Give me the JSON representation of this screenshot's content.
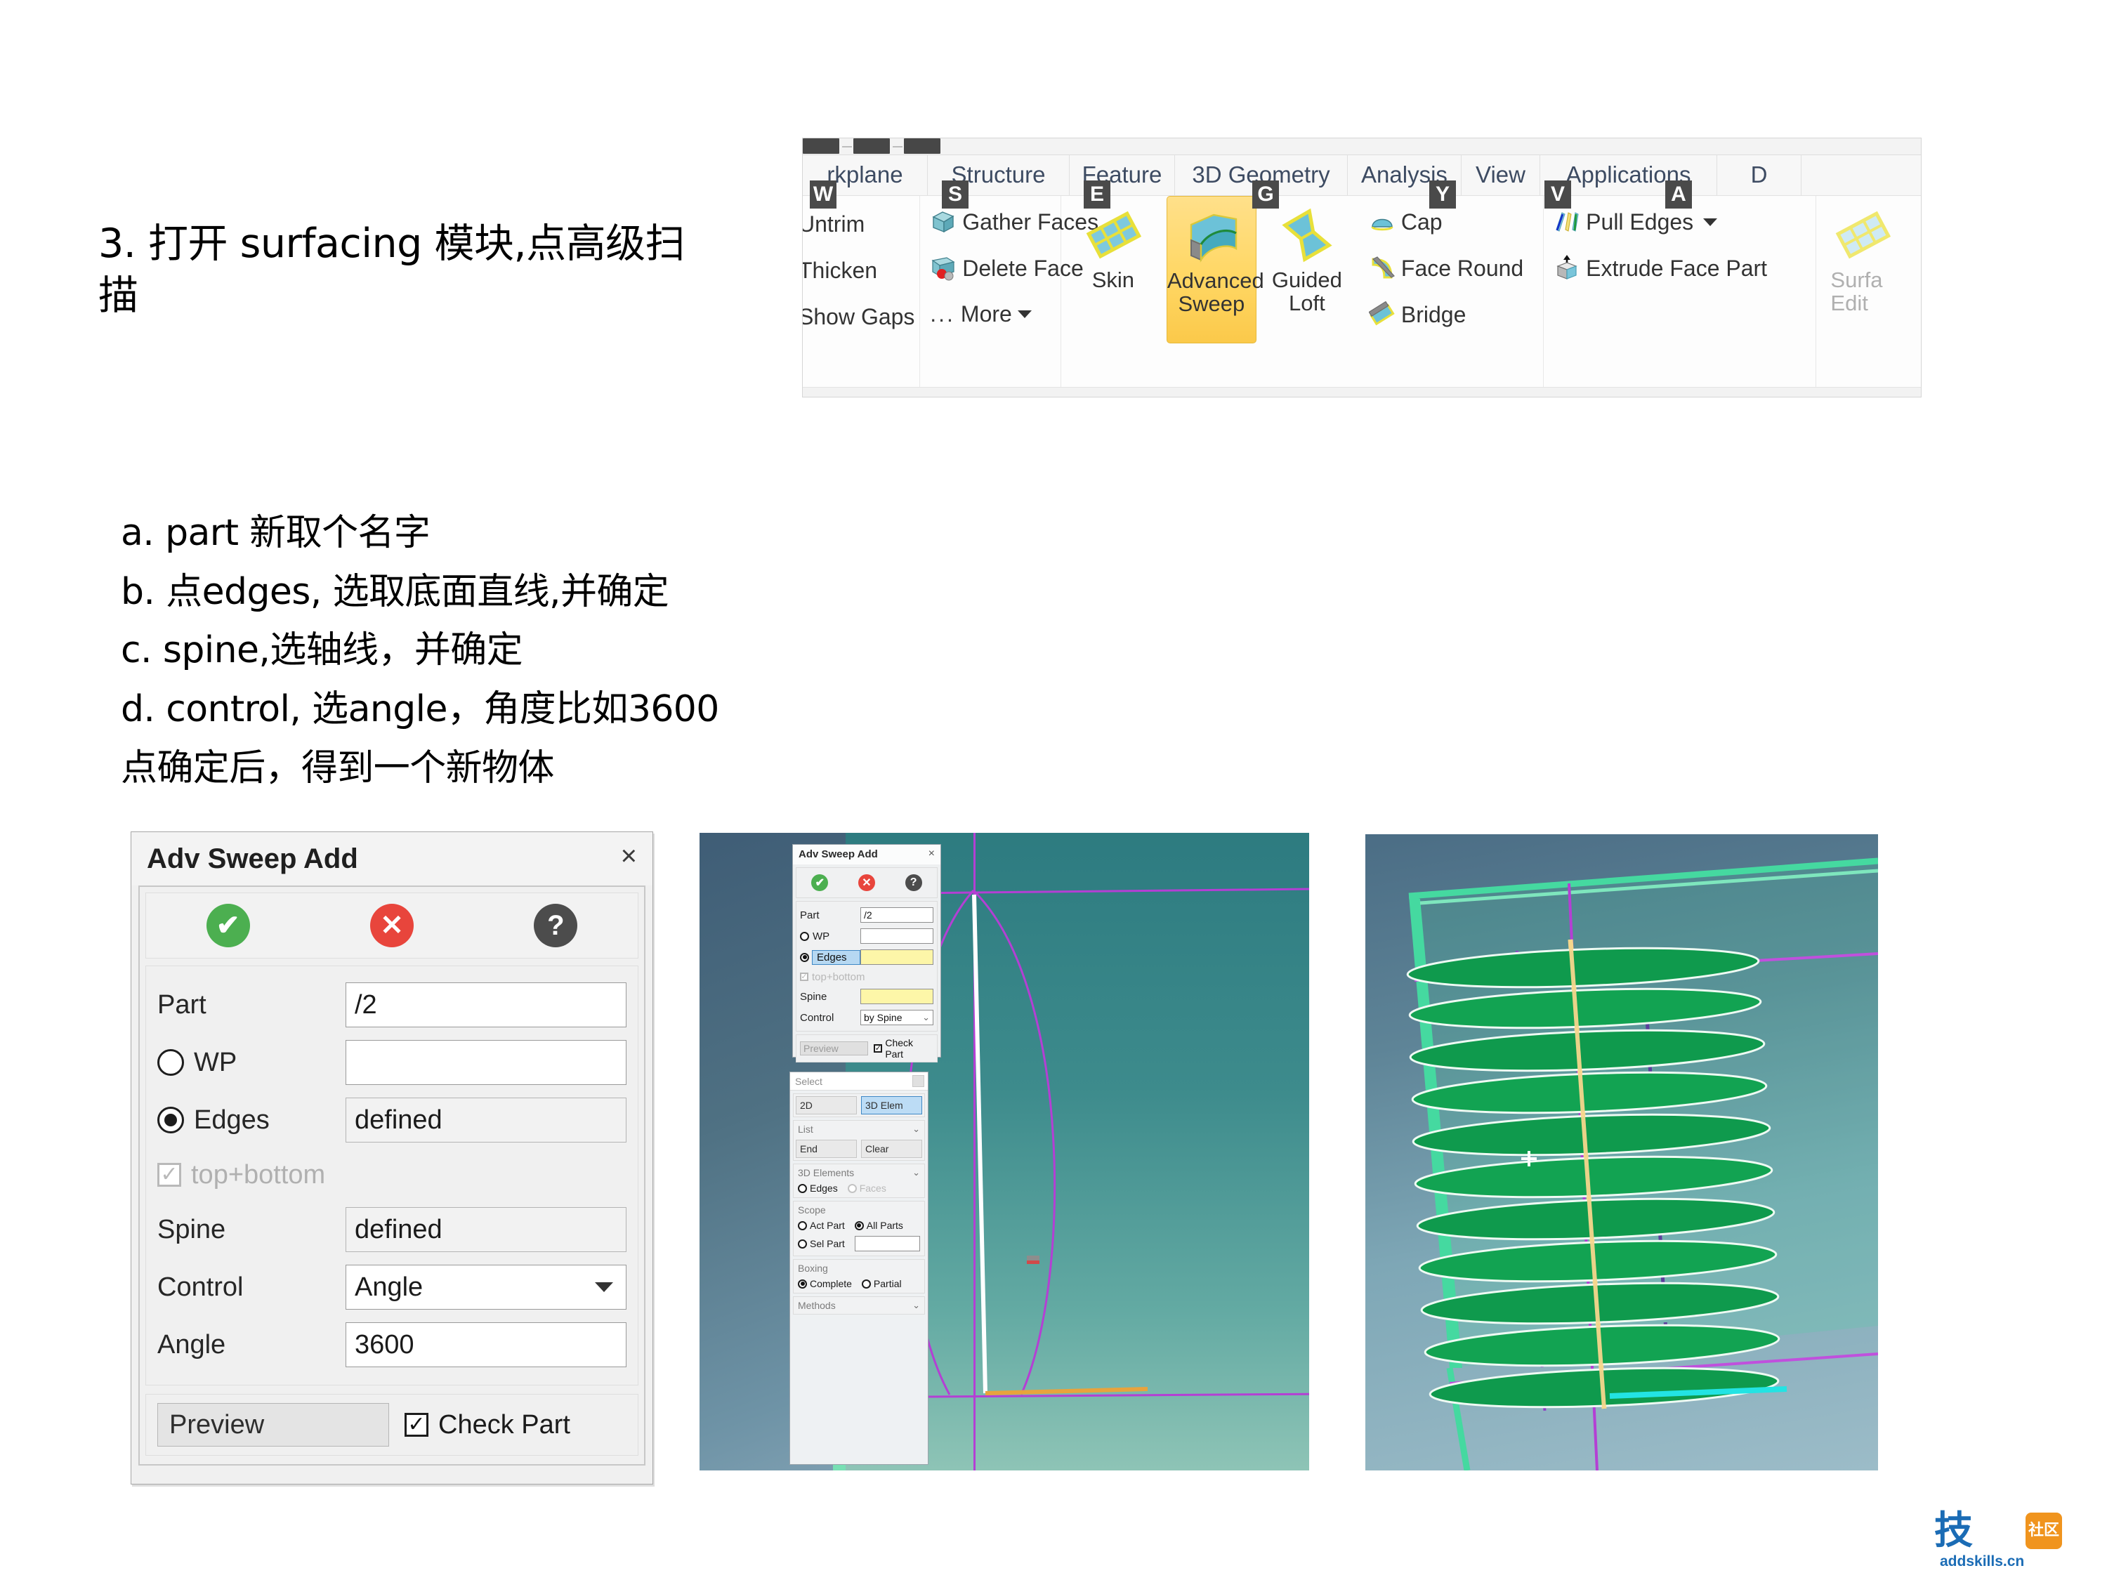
{
  "slide": {
    "heading_line1": "3. 打开 surfacing 模块,点高级扫",
    "heading_line2": "描",
    "steps": [
      "a. part 新取个名字",
      "b. 点edges, 选取底面直线,并确定",
      "c. spine,选轴线，并确定",
      "d. control, 选angle，角度比如3600",
      "点确定后，得到一个新物体"
    ]
  },
  "ribbon": {
    "tabs": [
      "rkplane",
      "Structure",
      "Feature",
      "3D Geometry",
      "Analysis",
      "View",
      "Applications",
      "D"
    ],
    "key_tips": [
      "W",
      "S",
      "E",
      "G",
      "Y",
      "V",
      "A"
    ],
    "group_workplane": {
      "items": [
        "Untrim",
        "Thicken",
        "Show Gaps",
        "More"
      ],
      "more_prefix": "..."
    },
    "group_structure": {
      "items": [
        {
          "label": "Gather Faces",
          "icon": "cube-icon"
        },
        {
          "label": "Delete Face",
          "icon": "delete-face-icon"
        }
      ]
    },
    "group_3dgeometry": {
      "big_buttons": [
        {
          "label_line1": "Skin",
          "label_line2": "",
          "icon": "skin-icon",
          "selected": false
        },
        {
          "label_line1": "Advanced",
          "label_line2": "Sweep",
          "icon": "advanced-sweep-icon",
          "selected": true
        },
        {
          "label_line1": "Guided",
          "label_line2": "Loft",
          "icon": "guided-loft-icon",
          "selected": false
        }
      ],
      "small_items": [
        {
          "label": "Cap",
          "icon": "cap-icon"
        },
        {
          "label": "Face Round",
          "icon": "face-round-icon"
        },
        {
          "label": "Bridge",
          "icon": "bridge-icon"
        }
      ]
    },
    "group_analysis": {
      "items": [
        {
          "label": "Pull Edges",
          "icon": "pull-edges-icon",
          "has_dropdown": true
        },
        {
          "label": "Extrude Face Part",
          "icon": "extrude-face-icon",
          "has_dropdown": false
        }
      ]
    },
    "group_trailing": {
      "label_line1": "Surfa",
      "label_line2": "Edit",
      "icon": "surface-edit-icon"
    }
  },
  "adv_dialog": {
    "title": "Adv Sweep Add",
    "close_label": "×",
    "actions": [
      {
        "name": "accept",
        "glyph": "✔",
        "color": "#4caf50"
      },
      {
        "name": "cancel",
        "glyph": "✕",
        "color": "#e8453c"
      },
      {
        "name": "help",
        "glyph": "?",
        "color": "#4c4c4c"
      }
    ],
    "fields": [
      {
        "label": "Part",
        "value": "/2",
        "type": "text"
      },
      {
        "label": "WP",
        "value": "",
        "type": "radio-text",
        "selected": false
      },
      {
        "label": "Edges",
        "value": "defined",
        "type": "radio-text",
        "selected": true
      },
      {
        "label": "top+bottom",
        "value": "",
        "type": "checkbox",
        "checked": true,
        "disabled": true
      },
      {
        "label": "Spine",
        "value": "defined",
        "type": "readonly"
      },
      {
        "label": "Control",
        "value": "Angle",
        "type": "combo"
      },
      {
        "label": "Angle",
        "value": "3600",
        "type": "text"
      }
    ],
    "preview_label": "Preview",
    "check_part_label": "Check Part",
    "check_part_checked": true
  },
  "mid_screenshot": {
    "dialog": {
      "title": "Adv Sweep Add",
      "close_label": "×",
      "fields": [
        {
          "label": "Part",
          "value": "/2",
          "type": "text"
        },
        {
          "label": "WP",
          "value": "",
          "type": "radio-text",
          "selected": false
        },
        {
          "label": "Edges",
          "value": "",
          "type": "radio-text",
          "selected": true,
          "highlighted": true,
          "input_yellow": true
        },
        {
          "label": "top+bottom",
          "value": "",
          "type": "checkbox",
          "checked": true,
          "disabled": true
        },
        {
          "label": "Spine",
          "value": "",
          "type": "yellow"
        },
        {
          "label": "Control",
          "value": "by Spine",
          "type": "combo"
        }
      ],
      "preview_label": "Preview",
      "check_part_label": "Check Part"
    },
    "select_panel": {
      "title": "Select",
      "mode_buttons": [
        {
          "label": "2D",
          "active": false
        },
        {
          "label": "3D Elem",
          "active": true
        }
      ],
      "list_header": "List",
      "list_buttons": [
        {
          "label": "End"
        },
        {
          "label": "Clear"
        }
      ],
      "elements_header": "3D Elements",
      "element_options": [
        {
          "label": "Edges",
          "selected": false,
          "disabled": false
        },
        {
          "label": "Faces",
          "selected": false,
          "disabled": true
        }
      ],
      "scope_header": "Scope",
      "scope_options": [
        {
          "label": "Act Part",
          "selected": false
        },
        {
          "label": "All Parts",
          "selected": true
        },
        {
          "label": "Sel Part",
          "selected": false
        }
      ],
      "scope_input_value": "",
      "boxing_header": "Boxing",
      "boxing_options": [
        {
          "label": "Complete",
          "selected": true
        },
        {
          "label": "Partial",
          "selected": false
        }
      ],
      "methods_header": "Methods"
    }
  },
  "right_screenshot": {
    "description": "3D viewport showing green helical swept surface around a vertical spine axis"
  },
  "watermark": {
    "main": "技",
    "badge": "社区",
    "url": "addskills.cn"
  },
  "colors": {
    "accent_yellow": "#ffd764",
    "green": "#4caf50",
    "red": "#e8453c",
    "dark": "#4c4c4c",
    "helix_green": "#119b4e",
    "spine_yellow": "#f5d68c",
    "purple": "#b43fd4",
    "brand_blue": "#1b6cb5",
    "brand_orange": "#f0941e"
  }
}
